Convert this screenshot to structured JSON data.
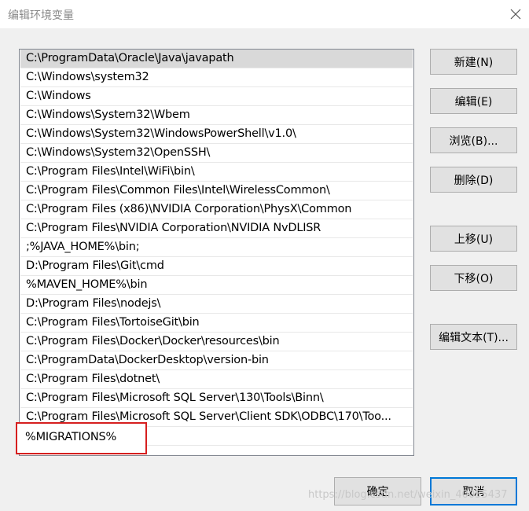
{
  "window": {
    "title": "编辑环境变量"
  },
  "paths": [
    "C:\\ProgramData\\Oracle\\Java\\javapath",
    "C:\\Windows\\system32",
    "C:\\Windows",
    "C:\\Windows\\System32\\Wbem",
    "C:\\Windows\\System32\\WindowsPowerShell\\v1.0\\",
    "C:\\Windows\\System32\\OpenSSH\\",
    "C:\\Program Files\\Intel\\WiFi\\bin\\",
    "C:\\Program Files\\Common Files\\Intel\\WirelessCommon\\",
    "C:\\Program Files (x86)\\NVIDIA Corporation\\PhysX\\Common",
    "C:\\Program Files\\NVIDIA Corporation\\NVIDIA NvDLISR",
    ";%JAVA_HOME%\\bin;",
    "D:\\Program Files\\Git\\cmd",
    "%MAVEN_HOME%\\bin",
    "D:\\Program Files\\nodejs\\",
    "C:\\Program Files\\TortoiseGit\\bin",
    "C:\\Program Files\\Docker\\Docker\\resources\\bin",
    "C:\\ProgramData\\DockerDesktop\\version-bin",
    "C:\\Program Files\\dotnet\\",
    "C:\\Program Files\\Microsoft SQL Server\\130\\Tools\\Binn\\",
    "C:\\Program Files\\Microsoft SQL Server\\Client SDK\\ODBC\\170\\Too..."
  ],
  "editing": {
    "value": "%MIGRATIONS%"
  },
  "buttons": {
    "new": "新建(N)",
    "edit": "编辑(E)",
    "browse": "浏览(B)...",
    "delete": "删除(D)",
    "move_up": "上移(U)",
    "move_down": "下移(O)",
    "edit_text": "编辑文本(T)...",
    "ok": "确定",
    "cancel": "取消"
  },
  "watermark": "https://blog.csdn.net/weixin_40055437",
  "colors": {
    "highlight_border": "#d61f1f",
    "primary_border": "#0078d7",
    "selected_row": "#d9d9d9"
  }
}
